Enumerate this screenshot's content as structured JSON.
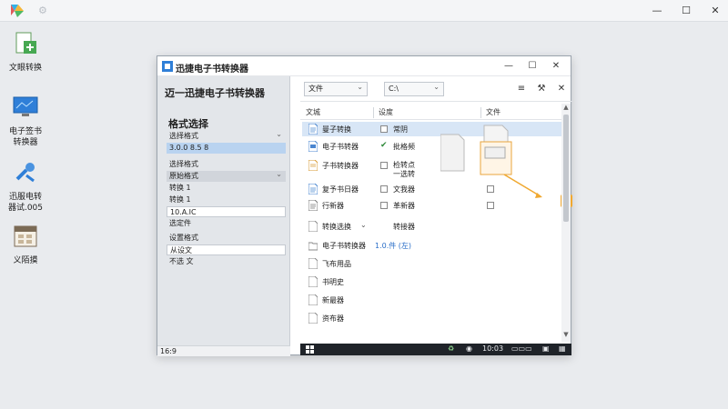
{
  "window_controls": {
    "minimize": "—",
    "maximize": "☐",
    "close": "✕"
  },
  "desktop_icons": [
    {
      "label": "文眼转换",
      "icon": "document-converter-icon"
    },
    {
      "label": "电子签书\n转换器",
      "icon": "monitor-icon"
    },
    {
      "label": "迅服电转\n器试.005",
      "icon": "tools-icon"
    },
    {
      "label": "义陌摸",
      "icon": "calendar-icon"
    }
  ],
  "app_window": {
    "title": "迅捷电子书转换器",
    "controls": {
      "minimize": "—",
      "maximize": "☐",
      "close": "✕"
    }
  },
  "left_panel": {
    "heading": "迈一迅捷电子书转换器",
    "section_title": "格式选择",
    "rows": [
      "选择格式",
      "3.0.0 8.5 8",
      "选择格式",
      "原始格式",
      "转换 1",
      "转换 1",
      "10.A.IC",
      "选定件",
      "设置格式",
      "从设文",
      "不选 文"
    ],
    "status": "16:9"
  },
  "right_panel": {
    "toolbar": {
      "select1": "文件",
      "select2": "C:\\"
    },
    "columns": {
      "name": "文城",
      "modified": "设度",
      "type": "文件"
    },
    "files": [
      {
        "name": "曼子转换",
        "meta": "常阴"
      },
      {
        "name": "电子书转器",
        "meta": "批格频"
      },
      {
        "name": "子书转换器",
        "meta": "检转点\n一选转"
      },
      {
        "name": "复予书日器",
        "meta": "文我器"
      },
      {
        "name": "行新器",
        "meta": "革新器"
      },
      {
        "name": "转换选换",
        "meta": "转接器"
      },
      {
        "name": "电子书转换器",
        "meta": "1.0.件 (左)"
      },
      {
        "name": "飞布用品",
        "meta": ""
      },
      {
        "name": "书明史",
        "meta": ""
      },
      {
        "name": "新最器",
        "meta": ""
      },
      {
        "name": "资布器",
        "meta": ""
      }
    ],
    "taskbar": {
      "time": "10:03"
    }
  },
  "colors": {
    "accent": "#f0a830",
    "selection": "#b9d3f0",
    "link": "#2a6ec8"
  }
}
